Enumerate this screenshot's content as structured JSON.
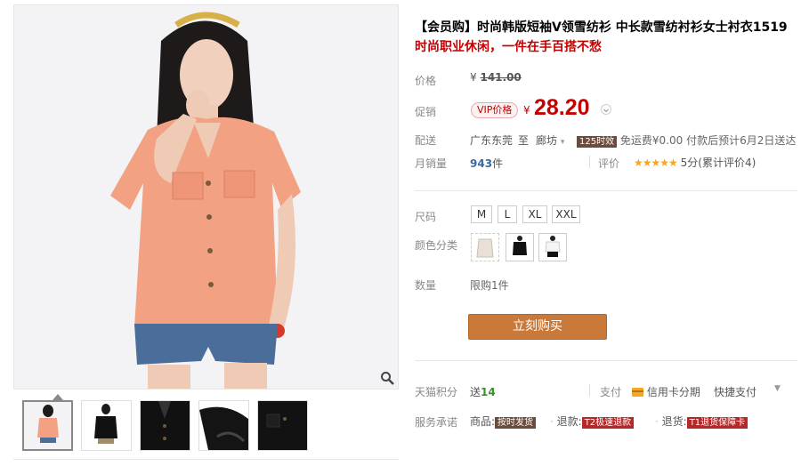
{
  "product": {
    "title": "【会员购】时尚韩版短袖V领雪纺衫 中长款雪纺衬衫女士衬衣1519",
    "subtitle": "时尚职业休闲，一件在手百搭不愁"
  },
  "price": {
    "label": "价格",
    "currency": "¥",
    "original": "141.00",
    "promo_label": "促销",
    "vip_badge": "VIP价格",
    "current": "28.20"
  },
  "delivery": {
    "label": "配送",
    "origin": "广东东莞",
    "to": "至",
    "destination": "廊坊",
    "tag": "125时效",
    "text": "免运费¥0.00 付款后预计6月2日送达"
  },
  "sales": {
    "label": "月销量",
    "count": "943",
    "unit": "件",
    "rating_label": "评价",
    "stars": "★★★★★",
    "rating_text": "5分(累计评价4)"
  },
  "options": {
    "size_label": "尺码",
    "sizes": [
      "M",
      "L",
      "XL",
      "XXL"
    ],
    "color_label": "颜色分类",
    "quantity_label": "数量",
    "quantity_limit": "限购1件"
  },
  "buy_button": "立刻购买",
  "points": {
    "label": "天猫积分",
    "text_prefix": "送",
    "value": "14"
  },
  "payment": {
    "label": "支付",
    "installment": "信用卡分期",
    "quick": "快捷支付"
  },
  "service": {
    "label": "服务承诺",
    "goods_label": "商品:",
    "goods_tag": "按时发货",
    "refund_label": "退款:",
    "refund_tag": "T2极速退款",
    "return_label": "退货:",
    "return_tag": "T1退货保障卡"
  },
  "colors": {
    "price_red": "#c40000",
    "buy_button": "#c97a3b",
    "shirt": "#f2a283"
  }
}
